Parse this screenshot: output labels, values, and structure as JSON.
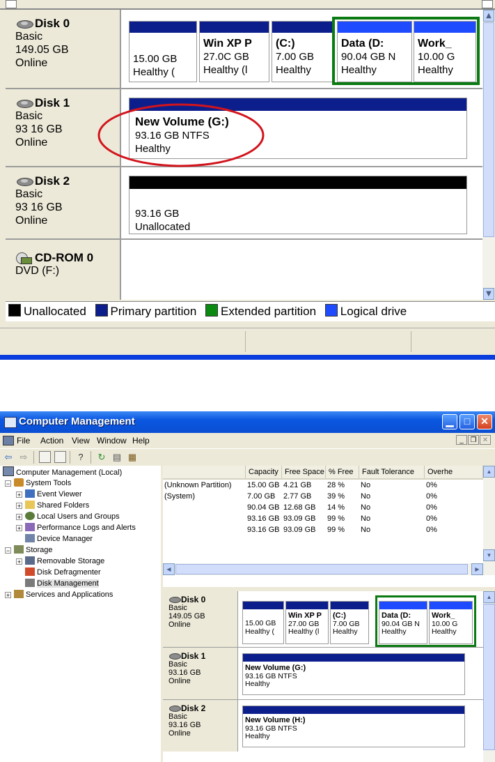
{
  "zoom": {
    "disks": [
      {
        "name": "Disk 0",
        "type": "Basic",
        "size": "149.05 GB",
        "status": "Online",
        "partitions": [
          {
            "title": "",
            "line1": "15.00 GB",
            "line2": "Healthy (",
            "kind": "primary"
          },
          {
            "title": "Win XP P",
            "line1": "27.0C GB",
            "line2": "Healthy (l",
            "kind": "primary"
          },
          {
            "title": "(C:)",
            "line1": "7.00 GB",
            "line2": "Healthy",
            "kind": "primary"
          },
          {
            "title": "Data  (D:",
            "line1": "90.04 GB N",
            "line2": "Healthy",
            "kind": "logical"
          },
          {
            "title": "Work_",
            "line1": "10.00 G",
            "line2": "Healthy",
            "kind": "logical"
          }
        ]
      },
      {
        "name": "Disk 1",
        "type": "Basic",
        "size": "93 16 GB",
        "status": "Online",
        "partition": {
          "title": "New Volume  (G:)",
          "line1": "93.16 GB NTFS",
          "line2": "Healthy"
        }
      },
      {
        "name": "Disk 2",
        "type": "Basic",
        "size": "93 16 GB",
        "status": "Online",
        "partition": {
          "line1": "93.16 GB",
          "line2": "Unallocated"
        }
      },
      {
        "name": "CD-ROM 0",
        "type": "DVD (F:)"
      }
    ],
    "legend": [
      "Unallocated",
      "Primary partition",
      "Extended partition",
      "Logical drive"
    ]
  },
  "colors": {
    "unallocated": "#000000",
    "primary": "#0c1e8c",
    "extended": "#0b8a12",
    "logical": "#1f4bff",
    "highlight_box": "#0b7a12",
    "annotation_circle": "#d2141c"
  },
  "window": {
    "title": "Computer Management",
    "menu": [
      "File",
      "Action",
      "View",
      "Window",
      "Help"
    ],
    "toolbar_icons": [
      "back-icon",
      "forward-icon",
      "up-folder-icon",
      "show-tree-icon",
      "help-icon",
      "refresh-icon",
      "properties-icon",
      "export-icon"
    ],
    "tree": [
      {
        "label": "Computer Management (Local)",
        "level": 0,
        "icon": "computer-icon"
      },
      {
        "label": "System Tools",
        "level": 1,
        "icon": "tools-icon",
        "expander": "−"
      },
      {
        "label": "Event Viewer",
        "level": 2,
        "icon": "event-viewer-icon",
        "expander": "+"
      },
      {
        "label": "Shared Folders",
        "level": 2,
        "icon": "shared-folder-icon",
        "expander": "+"
      },
      {
        "label": "Local Users and Groups",
        "level": 2,
        "icon": "users-icon",
        "expander": "+"
      },
      {
        "label": "Performance Logs and Alerts",
        "level": 2,
        "icon": "performance-icon",
        "expander": "+"
      },
      {
        "label": "Device Manager",
        "level": 2,
        "icon": "device-manager-icon"
      },
      {
        "label": "Storage",
        "level": 1,
        "icon": "storage-icon",
        "expander": "−"
      },
      {
        "label": "Removable Storage",
        "level": 2,
        "icon": "removable-storage-icon",
        "expander": "+"
      },
      {
        "label": "Disk Defragmenter",
        "level": 2,
        "icon": "defrag-icon"
      },
      {
        "label": "Disk Management",
        "level": 2,
        "icon": "disk-management-icon",
        "selected": true
      },
      {
        "label": "Services and Applications",
        "level": 1,
        "icon": "services-icon",
        "expander": "+"
      }
    ],
    "columns": [
      "",
      "Capacity",
      "Free Space",
      "% Free",
      "Fault Tolerance",
      "Overhe"
    ],
    "rows": [
      [
        "(Unknown Partition)",
        "15.00 GB",
        "4.21 GB",
        "28 %",
        "No",
        "0%"
      ],
      [
        "(System)",
        "7.00 GB",
        "2.77 GB",
        "39 %",
        "No",
        "0%"
      ],
      [
        "",
        "90.04 GB",
        "12.68 GB",
        "14 %",
        "No",
        "0%"
      ],
      [
        "",
        "93.16 GB",
        "93.09 GB",
        "99 %",
        "No",
        "0%"
      ],
      [
        "",
        "93.16 GB",
        "93.09 GB",
        "99 %",
        "No",
        "0%"
      ]
    ],
    "disks": [
      {
        "name": "Disk 0",
        "type": "Basic",
        "size": "149.05 GB",
        "status": "Online",
        "partitions": [
          {
            "title": "",
            "line1": "15.00 GB",
            "line2": "Healthy (",
            "kind": "primary"
          },
          {
            "title": "Win XP P",
            "line1": "27.00 GB",
            "line2": "Healthy (l",
            "kind": "primary"
          },
          {
            "title": "(C:)",
            "line1": "7.00 GB",
            "line2": "Healthy",
            "kind": "primary"
          },
          {
            "title": "Data  (D:",
            "line1": "90.04 GB N",
            "line2": "Healthy",
            "kind": "logical"
          },
          {
            "title": "Work_",
            "line1": "10.00 G",
            "line2": "Healthy",
            "kind": "logical"
          }
        ]
      },
      {
        "name": "Disk 1",
        "type": "Basic",
        "size": "93.16 GB",
        "status": "Online",
        "partition": {
          "title": "New Volume  (G:)",
          "line1": "93.16 GB NTFS",
          "line2": "Healthy"
        }
      },
      {
        "name": "Disk 2",
        "type": "Basic",
        "size": "93.16 GB",
        "status": "Online",
        "partition": {
          "title": "New Volume  (H:)",
          "line1": "93.16 GB NTFS",
          "line2": "Healthy"
        }
      }
    ]
  }
}
